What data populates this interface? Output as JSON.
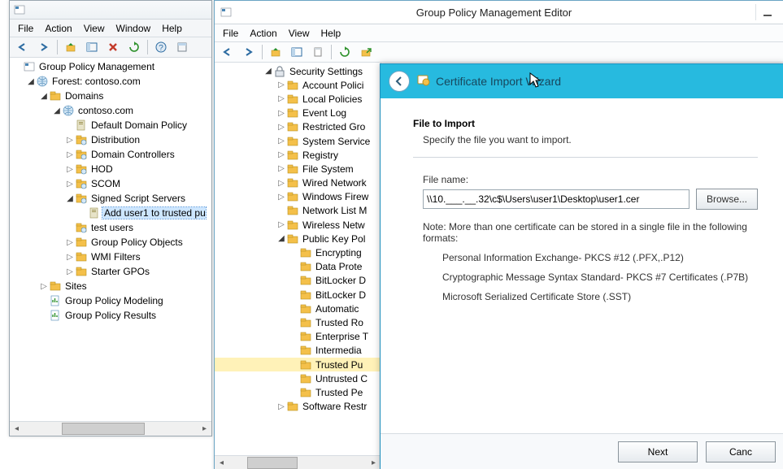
{
  "gpmc": {
    "menus": {
      "file": "File",
      "action": "Action",
      "view": "View",
      "window": "Window",
      "help": "Help"
    },
    "tree": [
      {
        "depth": 0,
        "exp": "none",
        "icon": "mmc",
        "label": "Group Policy Management"
      },
      {
        "depth": 1,
        "exp": "open",
        "icon": "globe",
        "label": "Forest: contoso.com"
      },
      {
        "depth": 2,
        "exp": "open",
        "icon": "folder",
        "label": "Domains"
      },
      {
        "depth": 3,
        "exp": "open",
        "icon": "globe",
        "label": "contoso.com"
      },
      {
        "depth": 4,
        "exp": "none",
        "icon": "gpo",
        "label": "Default Domain Policy"
      },
      {
        "depth": 4,
        "exp": "closed",
        "icon": "ou",
        "label": "Distribution"
      },
      {
        "depth": 4,
        "exp": "closed",
        "icon": "ou",
        "label": "Domain Controllers"
      },
      {
        "depth": 4,
        "exp": "closed",
        "icon": "ou",
        "label": "HOD"
      },
      {
        "depth": 4,
        "exp": "closed",
        "icon": "ou",
        "label": "SCOM"
      },
      {
        "depth": 4,
        "exp": "open",
        "icon": "ou",
        "label": "Signed Script Servers"
      },
      {
        "depth": 5,
        "exp": "none",
        "icon": "gpo",
        "label": "Add user1 to trusted pu",
        "selected": true
      },
      {
        "depth": 4,
        "exp": "none",
        "icon": "ou",
        "label": "test users"
      },
      {
        "depth": 4,
        "exp": "closed",
        "icon": "folder",
        "label": "Group Policy Objects"
      },
      {
        "depth": 4,
        "exp": "closed",
        "icon": "folder",
        "label": "WMI Filters"
      },
      {
        "depth": 4,
        "exp": "closed",
        "icon": "folder",
        "label": "Starter GPOs"
      },
      {
        "depth": 2,
        "exp": "closed",
        "icon": "folder",
        "label": "Sites"
      },
      {
        "depth": 2,
        "exp": "none",
        "icon": "report",
        "label": "Group Policy Modeling"
      },
      {
        "depth": 2,
        "exp": "none",
        "icon": "report",
        "label": "Group Policy Results"
      }
    ]
  },
  "gpeditor": {
    "title": "Group Policy Management Editor",
    "menus": {
      "file": "File",
      "action": "Action",
      "view": "View",
      "help": "Help"
    },
    "tree": [
      {
        "depth": 0,
        "exp": "open",
        "icon": "lock",
        "label": "Security Settings"
      },
      {
        "depth": 1,
        "exp": "closed",
        "icon": "folder",
        "label": "Account Polici"
      },
      {
        "depth": 1,
        "exp": "closed",
        "icon": "folder",
        "label": "Local Policies"
      },
      {
        "depth": 1,
        "exp": "closed",
        "icon": "folder",
        "label": "Event Log"
      },
      {
        "depth": 1,
        "exp": "closed",
        "icon": "folder",
        "label": "Restricted Gro"
      },
      {
        "depth": 1,
        "exp": "closed",
        "icon": "folder",
        "label": "System Service"
      },
      {
        "depth": 1,
        "exp": "closed",
        "icon": "folder",
        "label": "Registry"
      },
      {
        "depth": 1,
        "exp": "closed",
        "icon": "folder",
        "label": "File System"
      },
      {
        "depth": 1,
        "exp": "closed",
        "icon": "folder",
        "label": "Wired Network"
      },
      {
        "depth": 1,
        "exp": "closed",
        "icon": "folder",
        "label": "Windows Firew"
      },
      {
        "depth": 1,
        "exp": "none",
        "icon": "folder",
        "label": "Network List M"
      },
      {
        "depth": 1,
        "exp": "closed",
        "icon": "folder",
        "label": "Wireless Netw"
      },
      {
        "depth": 1,
        "exp": "open",
        "icon": "folder",
        "label": "Public Key Pol"
      },
      {
        "depth": 2,
        "exp": "none",
        "icon": "folder",
        "label": "Encrypting"
      },
      {
        "depth": 2,
        "exp": "none",
        "icon": "folder",
        "label": "Data Prote"
      },
      {
        "depth": 2,
        "exp": "none",
        "icon": "folder",
        "label": "BitLocker D"
      },
      {
        "depth": 2,
        "exp": "none",
        "icon": "folder",
        "label": "BitLocker D"
      },
      {
        "depth": 2,
        "exp": "none",
        "icon": "folder",
        "label": "Automatic"
      },
      {
        "depth": 2,
        "exp": "none",
        "icon": "folder",
        "label": "Trusted Ro"
      },
      {
        "depth": 2,
        "exp": "none",
        "icon": "folder",
        "label": "Enterprise T"
      },
      {
        "depth": 2,
        "exp": "none",
        "icon": "folder",
        "label": "Intermedia"
      },
      {
        "depth": 2,
        "exp": "none",
        "icon": "folder",
        "label": "Trusted Pu",
        "highlight": true
      },
      {
        "depth": 2,
        "exp": "none",
        "icon": "folder",
        "label": "Untrusted C"
      },
      {
        "depth": 2,
        "exp": "none",
        "icon": "folder",
        "label": "Trusted Pe"
      },
      {
        "depth": 1,
        "exp": "closed",
        "icon": "folder",
        "label": "Software Restr"
      }
    ]
  },
  "wizard": {
    "title": "Certificate Import Wizard",
    "section_title": "File to Import",
    "section_sub": "Specify the file you want to import.",
    "field_label": "File name:",
    "file_value": "\\\\10.___.__.32\\c$\\Users\\user1\\Desktop\\user1.cer",
    "browse": "Browse...",
    "note": "Note:  More than one certificate can be stored in a single file in the following formats:",
    "formats": [
      "Personal Information Exchange- PKCS #12 (.PFX,.P12)",
      "Cryptographic Message Syntax Standard- PKCS #7 Certificates (.P7B)",
      "Microsoft Serialized Certificate Store (.SST)"
    ],
    "next": "Next",
    "cancel": "Canc"
  }
}
